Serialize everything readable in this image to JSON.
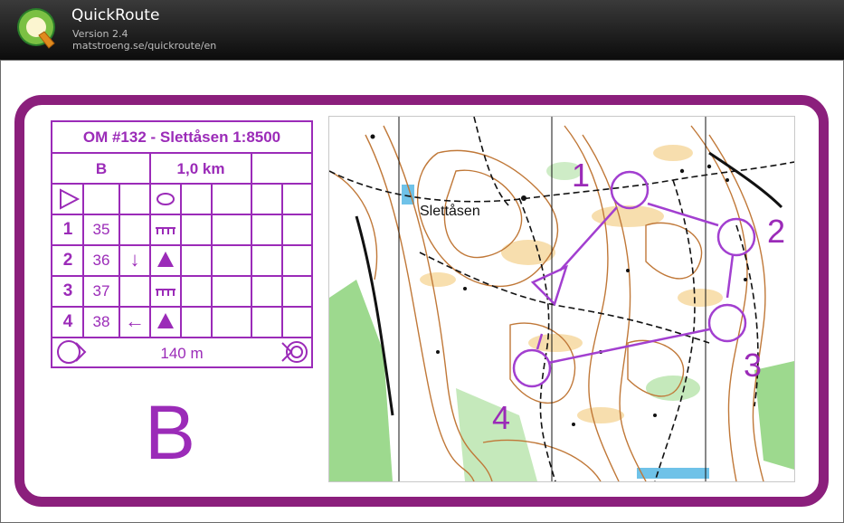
{
  "window": {
    "app_title": "QuickRoute",
    "version": "Version 2.4",
    "url": "matstroeng.se/quickroute/en"
  },
  "control_description": {
    "title": "OM #132 - Slettåsen 1:8500",
    "course": "B",
    "length": "1,0 km",
    "controls": [
      {
        "number": "1",
        "code": "35",
        "direction": "",
        "feature": "ruined-fence-symbol"
      },
      {
        "number": "2",
        "code": "36",
        "direction": "↓",
        "feature": "boulder-triangle-symbol"
      },
      {
        "number": "3",
        "code": "37",
        "direction": "",
        "feature": "ruined-fence-symbol"
      },
      {
        "number": "4",
        "code": "38",
        "direction": "←",
        "feature": "boulder-triangle-symbol"
      }
    ],
    "finish_distance": "140 m"
  },
  "big_course_letter": "B",
  "map": {
    "place_label": "Slettåsen",
    "control_numbers": [
      "1",
      "2",
      "3",
      "4"
    ]
  },
  "colors": {
    "course_purple": "#9b2bb8",
    "card_border": "#8b1f7c",
    "titlebar": "#1a1a1a"
  }
}
